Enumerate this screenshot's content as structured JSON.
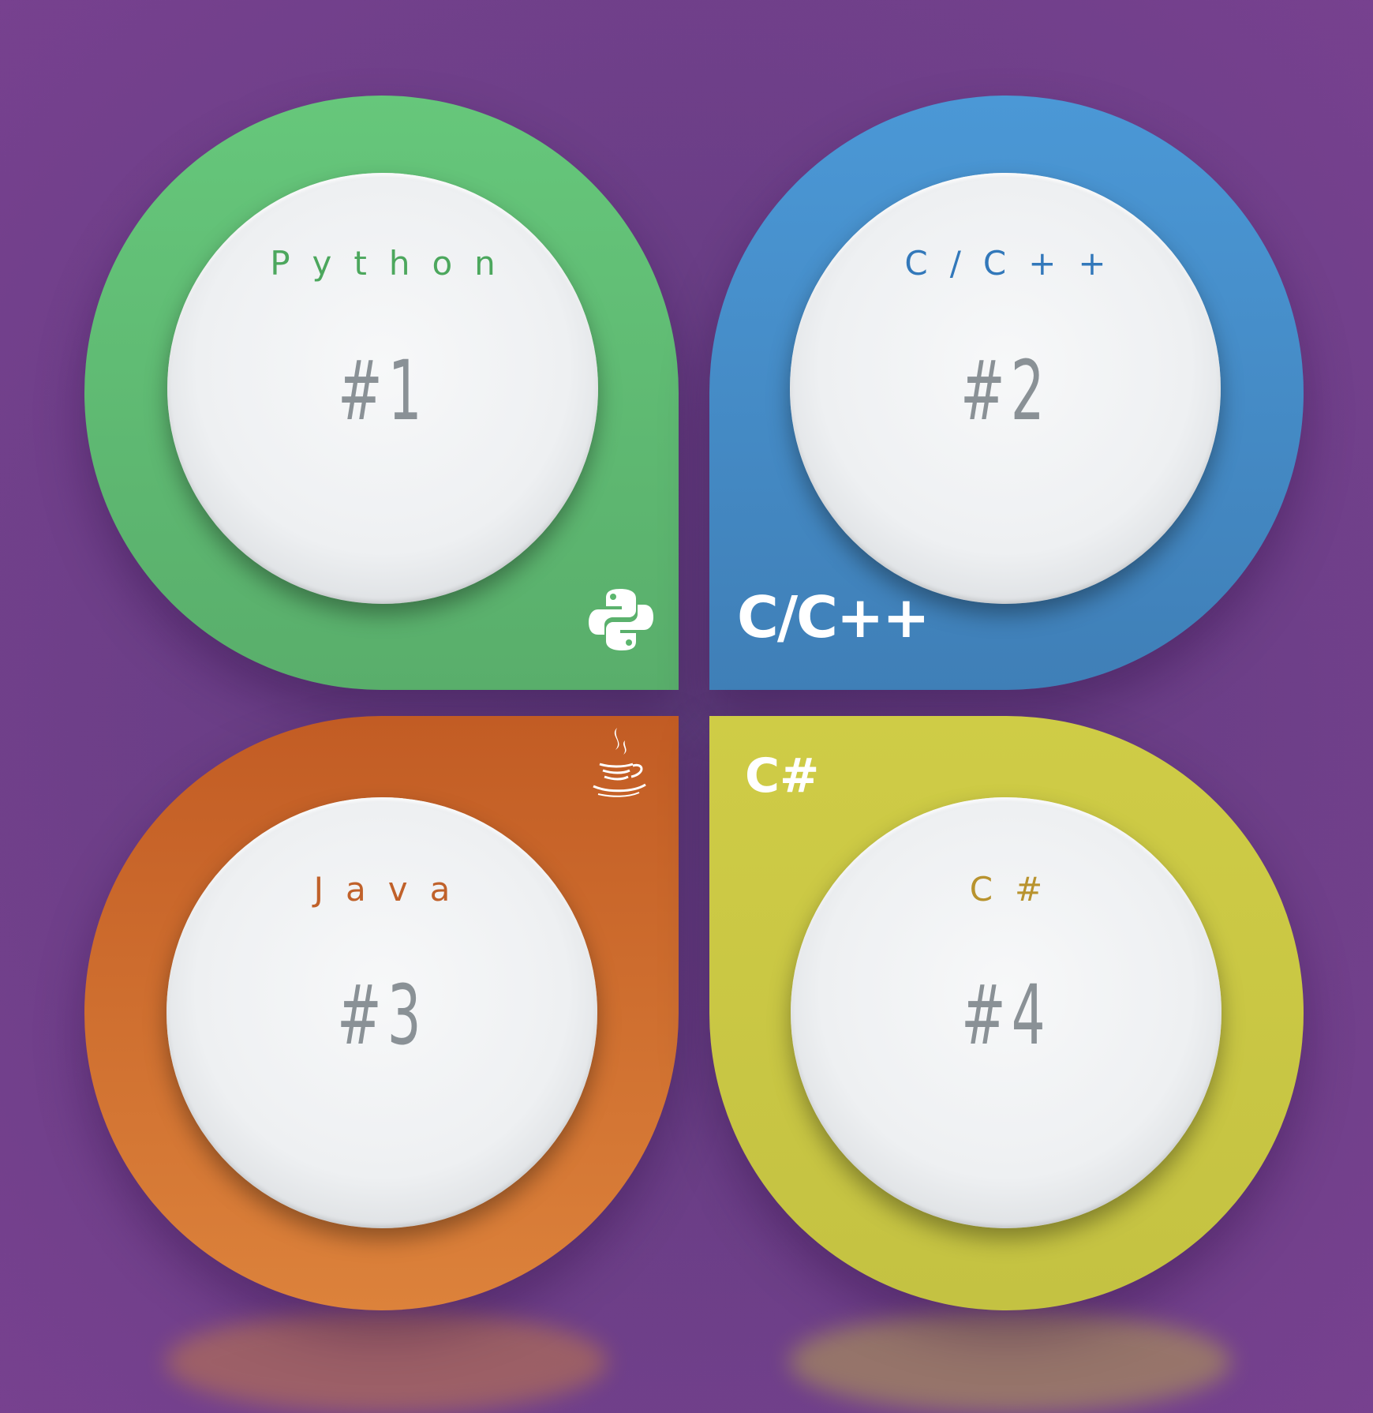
{
  "colors": {
    "background": "#6a3e86",
    "python": "#5fbd73",
    "cpp": "#4589c6",
    "java": "#d0722f",
    "csharp": "#c9c744",
    "rank_text": "#8a9196"
  },
  "items": [
    {
      "name": "Python",
      "rank": "#1",
      "text_color": "#4ca75d",
      "icon": "python-logo-icon"
    },
    {
      "name": "C/C++",
      "rank": "#2",
      "text_color": "#3278ba",
      "icon": "cpp-logo",
      "logo_text": "C/C++"
    },
    {
      "name": "Java",
      "rank": "#3",
      "text_color": "#c0612a",
      "icon": "java-cup-icon"
    },
    {
      "name": "C#",
      "rank": "#4",
      "text_color": "#b8932e",
      "icon": "csharp-logo",
      "logo_text": "C#"
    }
  ]
}
